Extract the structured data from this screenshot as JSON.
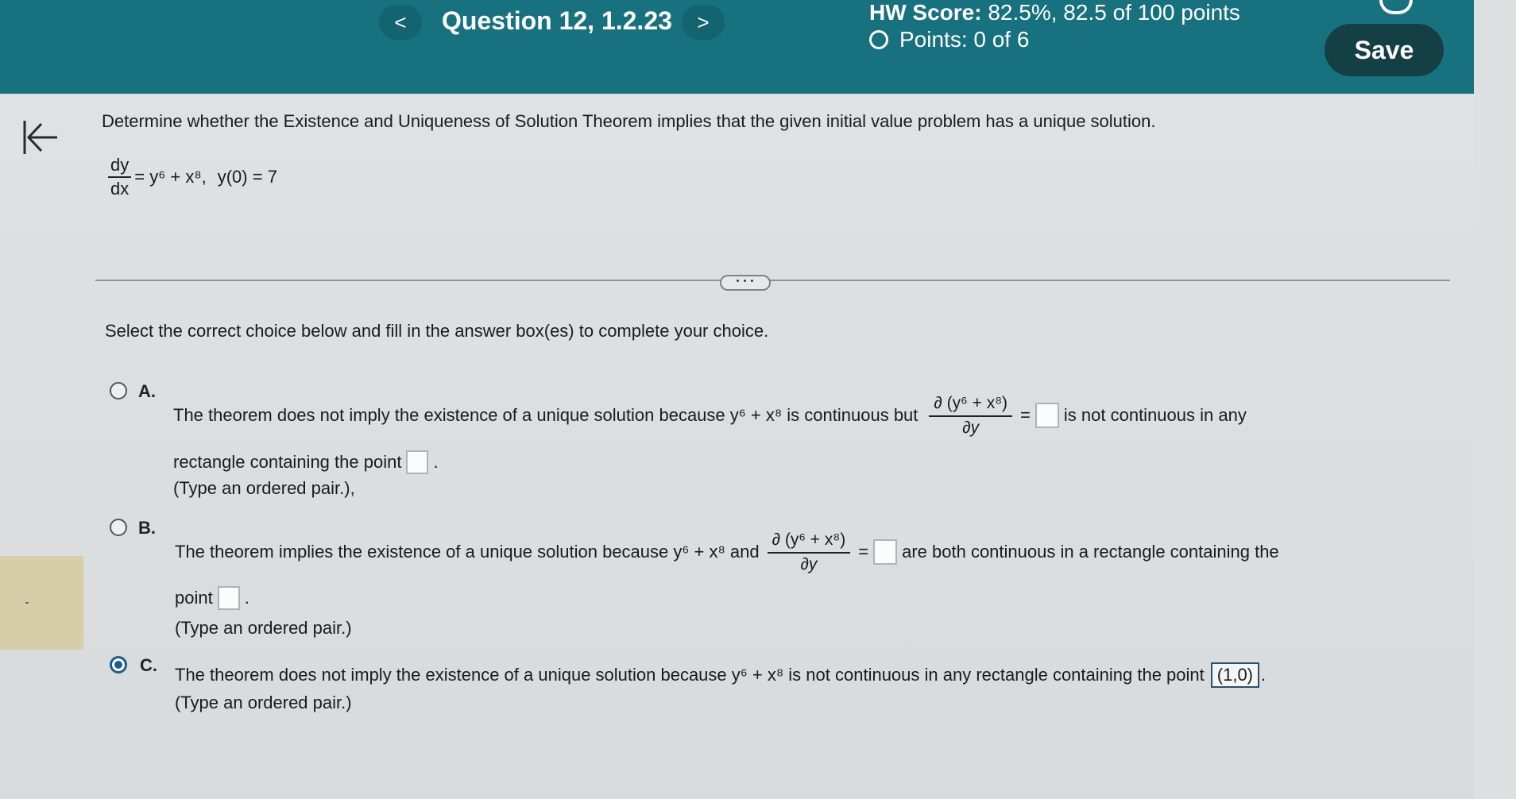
{
  "header": {
    "prev_label": "<",
    "question_title": "Question 12, 1.2.23",
    "next_label": ">",
    "hw_score_label": "HW Score:",
    "hw_score_value": "82.5%, 82.5 of 100 points",
    "points_text": "Points: 0 of 6",
    "save_label": "Save"
  },
  "problem": {
    "prompt": "Determine whether the Existence and Uniqueness of Solution Theorem implies that the given initial value problem has a unique solution.",
    "lhs_num": "dy",
    "lhs_den": "dx",
    "rhs": "= y⁶ + x⁸,",
    "initial_condition": "y(0) = 7"
  },
  "more_label": "• • •",
  "instruction": "Select the correct choice below and fill in the answer box(es) to complete your choice.",
  "partial": {
    "num": "∂ (y⁶ + x⁸)",
    "den": "∂y"
  },
  "choices": {
    "a": {
      "letter": "A.",
      "text1": "The theorem does not imply the existence of a unique solution because y⁶ + x⁸ is continuous but",
      "text2": "is not continuous in any",
      "text3": "rectangle containing the point",
      "note": "(Type an ordered pair.),"
    },
    "b": {
      "letter": "B.",
      "text1": "The theorem implies the existence of a unique solution because y⁶ + x⁸ and",
      "text2": "are both continuous in a rectangle containing the",
      "text3": "point",
      "note": "(Type an ordered pair.)"
    },
    "c": {
      "letter": "C.",
      "text1": "The theorem does not imply the existence of a unique solution because y⁶ + x⁸ is not continuous in any rectangle containing the point",
      "answer": "(1,0)",
      "note": "(Type an ordered pair.)"
    }
  },
  "selected_choice": "C",
  "colors": {
    "header_bg": "#17717e",
    "save_bg": "#143f45",
    "selected_radio": "#1d5c8a"
  }
}
